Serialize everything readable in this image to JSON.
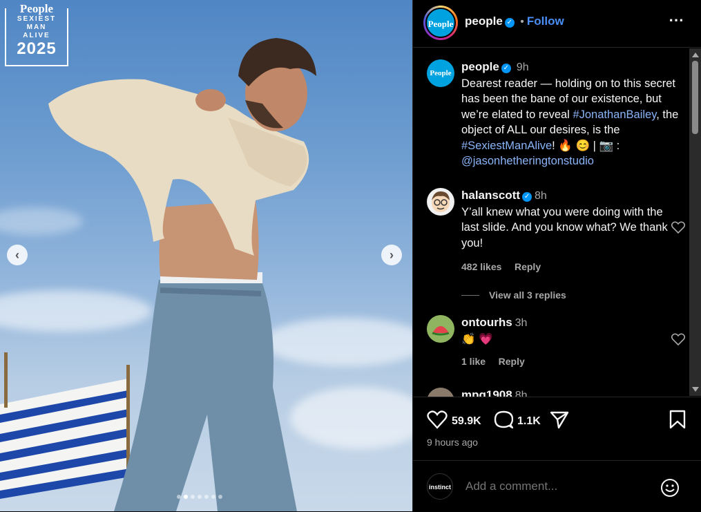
{
  "media": {
    "badge": {
      "brand": "People",
      "line1": "SEXIEST",
      "line2": "MAN",
      "line3": "ALIVE",
      "year": "2025"
    },
    "prev_icon": "chevron-left-icon",
    "next_icon": "chevron-right-icon",
    "slide_count": 6,
    "active_slide": 2
  },
  "header": {
    "username": "people",
    "follow_label": "Follow",
    "separator": "•",
    "avatar_text": "People",
    "more_icon": "more-horizontal-icon"
  },
  "caption": {
    "username": "people",
    "time": "9h",
    "text_1": "Dearest reader — holding on to this secret has been the bane of our existence, but we’re elated to reveal ",
    "hashtag_1": "#JonathanBailey",
    "text_2": ", the object of ALL our desires, is the ",
    "hashtag_2": "#SexiestManAlive",
    "text_3": "! 🔥 😊 | 📷 : ",
    "mention": "@jasonhetheringtonstudio"
  },
  "comments": [
    {
      "username": "halanscott",
      "time": "8h",
      "text": "Y’all knew what you were doing with the last slide. And you know what? We thank you!",
      "likes": "482 likes",
      "reply_label": "Reply",
      "view_replies": "View all 3 replies"
    },
    {
      "username": "ontourhs",
      "time": "3h",
      "text": "👏 💗",
      "likes": "1 like",
      "reply_label": "Reply"
    },
    {
      "username": "mpg1908",
      "time": "8h"
    }
  ],
  "actions": {
    "like_count": "59.9K",
    "comment_count": "1.1K",
    "posted_ago": "9 hours ago"
  },
  "add_comment": {
    "placeholder": "Add a comment...",
    "avatar_text": "instinct",
    "emoji_icon": "emoji-icon"
  },
  "colors": {
    "accent": "#0095f6",
    "link": "#8ab4f8",
    "follow": "#4a8ef7",
    "muted": "#a8a8a8"
  }
}
